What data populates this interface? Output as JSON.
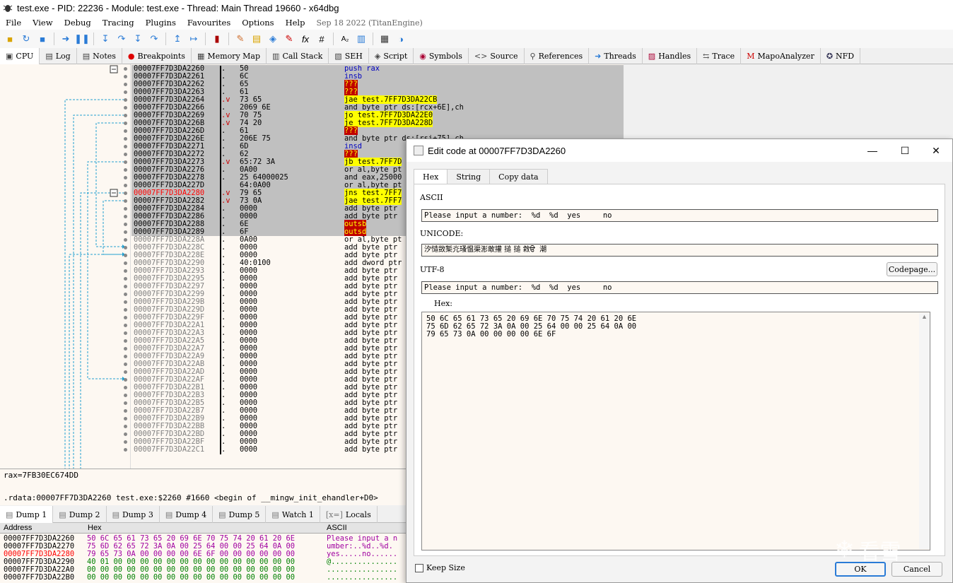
{
  "window": {
    "title": "test.exe - PID: 22236 - Module: test.exe - Thread: Main Thread 19660 - x64dbg"
  },
  "menu": {
    "items": [
      "File",
      "View",
      "Debug",
      "Tracing",
      "Plugins",
      "Favourites",
      "Options",
      "Help"
    ],
    "build_info": "Sep 18 2022 (TitanEngine)"
  },
  "tabs": [
    {
      "label": "CPU",
      "icon": "cpu-icon"
    },
    {
      "label": "Log",
      "icon": "log-icon"
    },
    {
      "label": "Notes",
      "icon": "notes-icon"
    },
    {
      "label": "Breakpoints",
      "icon": "breakpoint-icon"
    },
    {
      "label": "Memory Map",
      "icon": "memory-icon"
    },
    {
      "label": "Call Stack",
      "icon": "callstack-icon"
    },
    {
      "label": "SEH",
      "icon": "seh-icon"
    },
    {
      "label": "Script",
      "icon": "script-icon"
    },
    {
      "label": "Symbols",
      "icon": "symbols-icon"
    },
    {
      "label": "Source",
      "icon": "source-icon"
    },
    {
      "label": "References",
      "icon": "references-icon"
    },
    {
      "label": "Threads",
      "icon": "threads-icon"
    },
    {
      "label": "Handles",
      "icon": "handles-icon"
    },
    {
      "label": "Trace",
      "icon": "trace-icon"
    },
    {
      "label": "MapoAnalyzer",
      "icon": "mapo-icon"
    },
    {
      "label": "NFD",
      "icon": "nfd-icon"
    }
  ],
  "disasm": [
    {
      "addr": "00007FF7D3DA2260",
      "mk": ".",
      "bytes": "50",
      "ins": "push rax",
      "sel": true
    },
    {
      "addr": "00007FF7D3DA2261",
      "mk": ".",
      "bytes": "6C",
      "ins": "insb",
      "sel": true
    },
    {
      "addr": "00007FF7D3DA2262",
      "mk": ".",
      "bytes": "65",
      "ins": "???",
      "sel": true
    },
    {
      "addr": "00007FF7D3DA2263",
      "mk": ".",
      "bytes": "61",
      "ins": "???",
      "sel": true
    },
    {
      "addr": "00007FF7D3DA2264",
      "mk": ".v",
      "bytes": "73 65",
      "ins": "jae test.7FF7D3DA22CB",
      "sel": true
    },
    {
      "addr": "00007FF7D3DA2266",
      "mk": ".",
      "bytes": "2069 6E",
      "ins": "and byte ptr ds:[rcx+6E],ch",
      "sel": true
    },
    {
      "addr": "00007FF7D3DA2269",
      "mk": ".v",
      "bytes": "70 75",
      "ins": "jo test.7FF7D3DA22E0",
      "sel": true
    },
    {
      "addr": "00007FF7D3DA226B",
      "mk": ".v",
      "bytes": "74 20",
      "ins": "je test.7FF7D3DA228D",
      "sel": true
    },
    {
      "addr": "00007FF7D3DA226D",
      "mk": ".",
      "bytes": "61",
      "ins": "???",
      "sel": true
    },
    {
      "addr": "00007FF7D3DA226E",
      "mk": ".",
      "bytes": "206E 75",
      "ins": "and byte ptr ds:[rsi+75],ch",
      "sel": true
    },
    {
      "addr": "00007FF7D3DA2271",
      "mk": ".",
      "bytes": "6D",
      "ins": "insd",
      "sel": true
    },
    {
      "addr": "00007FF7D3DA2272",
      "mk": ".",
      "bytes": "62",
      "ins": "???",
      "sel": true
    },
    {
      "addr": "00007FF7D3DA2273",
      "mk": ".v",
      "bytes": "65:72 3A",
      "ins": "jb test.7FF7D",
      "sel": true
    },
    {
      "addr": "00007FF7D3DA2276",
      "mk": ".",
      "bytes": "0A00",
      "ins": "or al,byte pt",
      "sel": true
    },
    {
      "addr": "00007FF7D3DA2278",
      "mk": ".",
      "bytes": "25 64000025",
      "ins": "and eax,25000",
      "sel": true
    },
    {
      "addr": "00007FF7D3DA227D",
      "mk": "",
      "bytes": "64:0A00",
      "ins": "or al,byte pt",
      "sel": true
    },
    {
      "addr": "00007FF7D3DA2280",
      "mk": ".v",
      "bytes": "79 65",
      "ins": "jns test.7FF7",
      "sel": true,
      "red": true
    },
    {
      "addr": "00007FF7D3DA2282",
      "mk": ".v",
      "bytes": "73 0A",
      "ins": "jae test.7FF7",
      "sel": true
    },
    {
      "addr": "00007FF7D3DA2284",
      "mk": ".",
      "bytes": "0000",
      "ins": "add byte ptr",
      "sel": true
    },
    {
      "addr": "00007FF7D3DA2286",
      "mk": ".",
      "bytes": "0000",
      "ins": "add byte ptr",
      "sel": true
    },
    {
      "addr": "00007FF7D3DA2288",
      "mk": ".",
      "bytes": "6E",
      "ins": "outsb",
      "sel": true
    },
    {
      "addr": "00007FF7D3DA2289",
      "mk": ".",
      "bytes": "6F",
      "ins": "outsd",
      "sel": true
    },
    {
      "addr": "00007FF7D3DA228A",
      "mk": ".",
      "bytes": "0A00",
      "ins": "or al,byte pt"
    },
    {
      "addr": "00007FF7D3DA228C",
      "mk": ".",
      "bytes": "0000",
      "ins": "add byte ptr"
    },
    {
      "addr": "00007FF7D3DA228E",
      "mk": ".",
      "bytes": "0000",
      "ins": "add byte ptr"
    },
    {
      "addr": "00007FF7D3DA2290",
      "mk": ".",
      "bytes": "40:0100",
      "ins": "add dword ptr"
    },
    {
      "addr": "00007FF7D3DA2293",
      "mk": ".",
      "bytes": "0000",
      "ins": "add byte ptr"
    },
    {
      "addr": "00007FF7D3DA2295",
      "mk": ".",
      "bytes": "0000",
      "ins": "add byte ptr"
    },
    {
      "addr": "00007FF7D3DA2297",
      "mk": ".",
      "bytes": "0000",
      "ins": "add byte ptr"
    },
    {
      "addr": "00007FF7D3DA2299",
      "mk": ".",
      "bytes": "0000",
      "ins": "add byte ptr"
    },
    {
      "addr": "00007FF7D3DA229B",
      "mk": ".",
      "bytes": "0000",
      "ins": "add byte ptr"
    },
    {
      "addr": "00007FF7D3DA229D",
      "mk": ".",
      "bytes": "0000",
      "ins": "add byte ptr"
    },
    {
      "addr": "00007FF7D3DA229F",
      "mk": ".",
      "bytes": "0000",
      "ins": "add byte ptr"
    },
    {
      "addr": "00007FF7D3DA22A1",
      "mk": ".",
      "bytes": "0000",
      "ins": "add byte ptr"
    },
    {
      "addr": "00007FF7D3DA22A3",
      "mk": ".",
      "bytes": "0000",
      "ins": "add byte ptr"
    },
    {
      "addr": "00007FF7D3DA22A5",
      "mk": ".",
      "bytes": "0000",
      "ins": "add byte ptr"
    },
    {
      "addr": "00007FF7D3DA22A7",
      "mk": ".",
      "bytes": "0000",
      "ins": "add byte ptr"
    },
    {
      "addr": "00007FF7D3DA22A9",
      "mk": ".",
      "bytes": "0000",
      "ins": "add byte ptr"
    },
    {
      "addr": "00007FF7D3DA22AB",
      "mk": ".",
      "bytes": "0000",
      "ins": "add byte ptr"
    },
    {
      "addr": "00007FF7D3DA22AD",
      "mk": ".",
      "bytes": "0000",
      "ins": "add byte ptr"
    },
    {
      "addr": "00007FF7D3DA22AF",
      "mk": ".",
      "bytes": "0000",
      "ins": "add byte ptr"
    },
    {
      "addr": "00007FF7D3DA22B1",
      "mk": ".",
      "bytes": "0000",
      "ins": "add byte ptr"
    },
    {
      "addr": "00007FF7D3DA22B3",
      "mk": ".",
      "bytes": "0000",
      "ins": "add byte ptr"
    },
    {
      "addr": "00007FF7D3DA22B5",
      "mk": ".",
      "bytes": "0000",
      "ins": "add byte ptr"
    },
    {
      "addr": "00007FF7D3DA22B7",
      "mk": ".",
      "bytes": "0000",
      "ins": "add byte ptr"
    },
    {
      "addr": "00007FF7D3DA22B9",
      "mk": ".",
      "bytes": "0000",
      "ins": "add byte ptr"
    },
    {
      "addr": "00007FF7D3DA22BB",
      "mk": ".",
      "bytes": "0000",
      "ins": "add byte ptr"
    },
    {
      "addr": "00007FF7D3DA22BD",
      "mk": ".",
      "bytes": "0000",
      "ins": "add byte ptr"
    },
    {
      "addr": "00007FF7D3DA22BF",
      "mk": ".",
      "bytes": "0000",
      "ins": "add byte ptr"
    },
    {
      "addr": "00007FF7D3DA22C1",
      "mk": ".",
      "bytes": "0000",
      "ins": "add byte ptr"
    }
  ],
  "info": {
    "line1": "rax=7FB30EC674DD",
    "line2": ".rdata:00007FF7D3DA2260 test.exe:$2260 #1660 <begin of __mingw_init_ehandler+D0>"
  },
  "dump_tabs": [
    "Dump 1",
    "Dump 2",
    "Dump 3",
    "Dump 4",
    "Dump 5",
    "Watch 1",
    "Locals"
  ],
  "dump": {
    "headers": {
      "address": "Address",
      "hex": "Hex",
      "ascii": "ASCII"
    },
    "rows": [
      {
        "addr": "00007FF7D3DA2260",
        "hex": "50 6C 65 61 73 65 20 69 6E 70 75 74 20 61 20 6E",
        "ascii": "Please input a n"
      },
      {
        "addr": "00007FF7D3DA2270",
        "hex": "75 6D 62 65 72 3A 0A 00 25 64 00 00 25 64 0A 00",
        "ascii": "umber:..%d..%d."
      },
      {
        "addr": "00007FF7D3DA2280",
        "hex": "79 65 73 0A 00 00 00 00 6E 6F 00 00 00 00 00 00",
        "ascii": "yes.....no......",
        "red": true
      },
      {
        "addr": "00007FF7D3DA2290",
        "hex": "40 01 00 00 00 00 00 00 00 00 00 00 00 00 00 00",
        "ascii": "@..............."
      },
      {
        "addr": "00007FF7D3DA22A0",
        "hex": "00 00 00 00 00 00 00 00 00 00 00 00 00 00 00 00",
        "ascii": "................"
      },
      {
        "addr": "00007FF7D3DA22B0",
        "hex": "00 00 00 00 00 00 00 00 00 00 00 00 00 00 00 00",
        "ascii": "................"
      }
    ]
  },
  "dialog": {
    "title": "Edit code at 00007FF7D3DA2260",
    "tabs": [
      "Hex",
      "String",
      "Copy data"
    ],
    "ascii_label": "ASCII",
    "ascii_value": "Please input a number:  %d  %d  yes     no",
    "unicode_label": "UNICODE:",
    "unicode_value": "汐慥敳椠灮瑵愠渠浵敢㩲 ‍搥 ‍搥 敹ੳ  潮",
    "utf8_label": "UTF-8",
    "codepage_label": "Codepage...",
    "utf8_value": "Please input a number:  %d  %d  yes     no",
    "hex_label": "Hex:",
    "hex_value": "50 6C 65 61 73 65 20 69 6E 70 75 74 20 61 20 6E\n75 6D 62 65 72 3A 0A 00 25 64 00 00 25 64 0A 00\n79 65 73 0A 00 00 00 00 6E 6F",
    "keep_size_label": "Keep Size",
    "ok_label": "OK",
    "cancel_label": "Cancel"
  },
  "watermark": {
    "text": "看雪"
  }
}
